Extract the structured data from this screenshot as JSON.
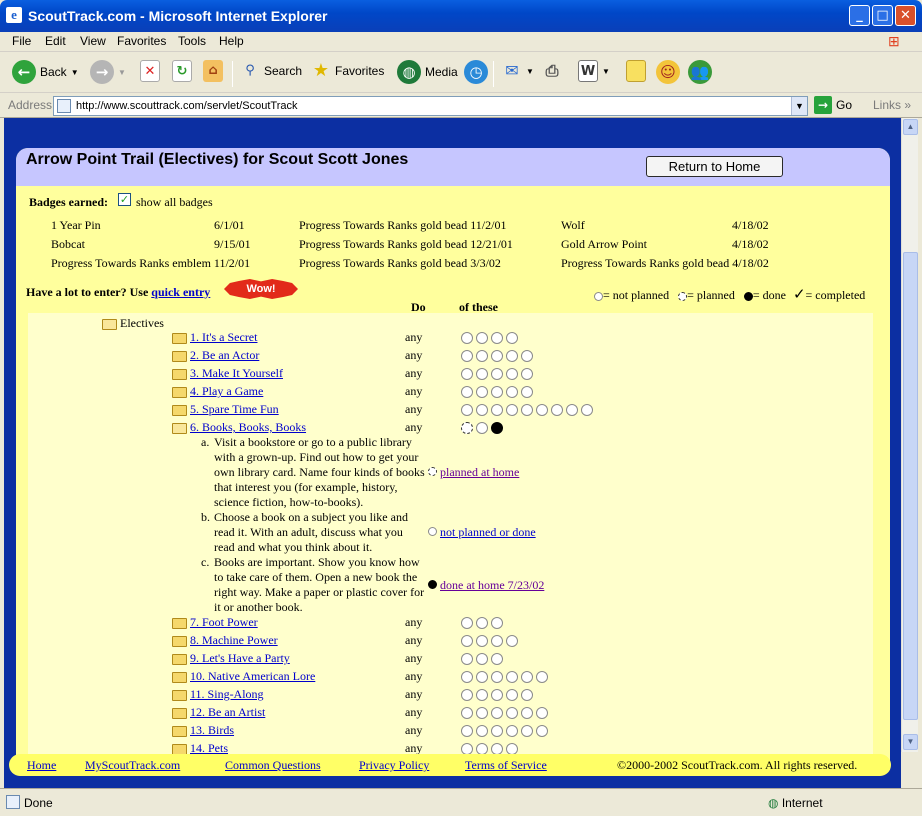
{
  "window": {
    "title": "ScoutTrack.com - Microsoft Internet Explorer"
  },
  "menu": [
    "File",
    "Edit",
    "View",
    "Favorites",
    "Tools",
    "Help"
  ],
  "toolbar": {
    "back": "Back",
    "search": "Search",
    "favorites": "Favorites",
    "media": "Media"
  },
  "address": {
    "label": "Address",
    "url": "http://www.scouttrack.com/servlet/ScoutTrack",
    "go": "Go",
    "links": "Links"
  },
  "status": {
    "text": "Done",
    "zone": "Internet"
  },
  "page": {
    "title": "Arrow Point Trail (Electives) for Scout Scott Jones",
    "home_button": "Return to Home",
    "badges_label": "Badges earned:",
    "show_all": "show all badges",
    "badges": [
      {
        "name": "1 Year Pin",
        "date": "6/1/01"
      },
      {
        "name": "Progress Towards Ranks gold bead 11/2/01",
        "date": ""
      },
      {
        "name": "Wolf",
        "date": "4/18/02"
      },
      {
        "name": "Bobcat",
        "date": "9/15/01"
      },
      {
        "name": "Progress Towards Ranks gold bead 12/21/01",
        "date": ""
      },
      {
        "name": "Gold Arrow Point",
        "date": "4/18/02"
      },
      {
        "name": "Progress Towards Ranks emblem 11/2/01",
        "date": ""
      },
      {
        "name": "Progress Towards Ranks gold bead 3/3/02",
        "date": ""
      },
      {
        "name": "Progress Towards Ranks gold bead 4/18/02",
        "date": ""
      }
    ],
    "quick_prefix": "Have a lot to enter? Use",
    "quick_link": "quick entry",
    "wow": "Wow!",
    "legend": {
      "not_planned": "= not planned",
      "planned": "= planned",
      "done": "= done",
      "completed": "= completed"
    },
    "col_do": "Do",
    "col_of": "of these",
    "root": "Electives",
    "any": "any",
    "electives": [
      {
        "label": "1. It's a Secret",
        "paws": 4
      },
      {
        "label": "2. Be an Actor",
        "paws": 5
      },
      {
        "label": "3. Make It Yourself",
        "paws": 5
      },
      {
        "label": "4. Play a Game",
        "paws": 5
      },
      {
        "label": "5. Spare Time Fun",
        "paws": 9
      },
      {
        "label": "6. Books, Books, Books",
        "paws": 3
      },
      {
        "label": "7. Foot Power",
        "paws": 3
      },
      {
        "label": "8. Machine Power",
        "paws": 4
      },
      {
        "label": "9. Let's Have a Party",
        "paws": 3
      },
      {
        "label": "10. Native American Lore",
        "paws": 6
      },
      {
        "label": "11. Sing-Along",
        "paws": 5
      },
      {
        "label": "12. Be an Artist",
        "paws": 6
      },
      {
        "label": "13. Birds",
        "paws": 6
      },
      {
        "label": "14. Pets",
        "paws": 4
      }
    ],
    "requirements": [
      {
        "letter": "a.",
        "text": "Visit a bookstore or go to a public library with a grown-up. Find out how to get your own library card. Name four kinds of books that interest you (for example, history, science fiction, how-to-books).",
        "status": "planned at home "
      },
      {
        "letter": "b.",
        "text": "Choose a book on a subject you like and read it. With an adult, discuss what you read and what you think about it.",
        "status": "not planned or done"
      },
      {
        "letter": "c.",
        "text": "Books are important. Show you know how to take care of them. Open a new book the right way. Make a paper or plastic cover for it or another book.",
        "status": "done at home 7/23/02"
      }
    ],
    "footer": {
      "home": "Home",
      "my": "MyScoutTrack.com",
      "faq": "Common Questions",
      "privacy": "Privacy Policy",
      "terms": "Terms of Service",
      "copyright": "©2000-2002 ScoutTrack.com. All rights reserved."
    }
  }
}
